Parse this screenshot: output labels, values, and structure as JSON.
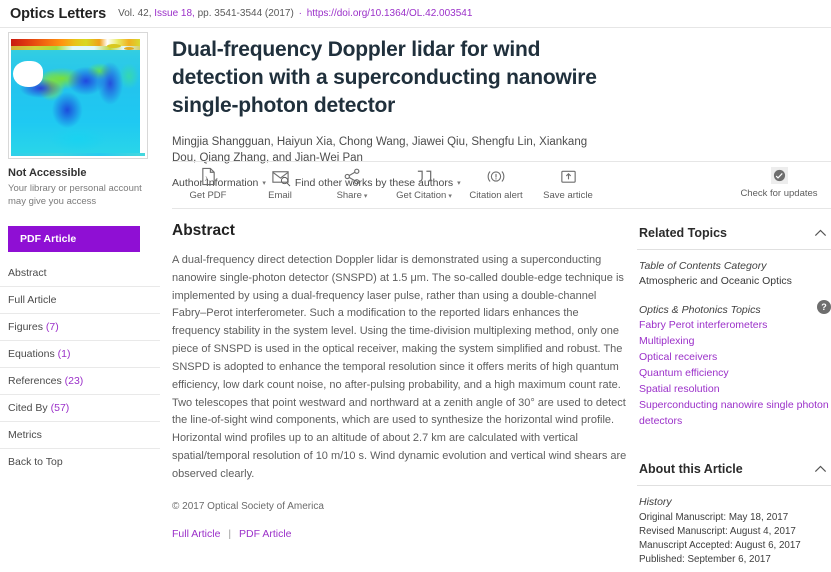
{
  "journal_header": {
    "name": "Optics Letters",
    "volume": "Vol. 42,",
    "issue": "Issue 18,",
    "pages": "pp. 3541-3544 (2017)",
    "separator": "·",
    "doi": "https://doi.org/10.1364/OL.42.003541"
  },
  "left": {
    "thumbnail_name": "article-figure-thumbnail",
    "access_title": "Not Accessible",
    "access_sub": "Your library or personal account may give you access",
    "pdf_button": "PDF Article",
    "nav": [
      {
        "label": "Abstract",
        "count": ""
      },
      {
        "label": "Full Article",
        "count": ""
      },
      {
        "label": "Figures",
        "count": "(7)"
      },
      {
        "label": "Equations",
        "count": "(1)"
      },
      {
        "label": "References",
        "count": "(23)"
      },
      {
        "label": "Cited By",
        "count": "(57)"
      },
      {
        "label": "Metrics",
        "count": ""
      },
      {
        "label": "Back to Top",
        "count": ""
      }
    ]
  },
  "article": {
    "title": "Dual-frequency Doppler lidar for wind detection with a superconducting nanowire single-photon detector",
    "authors": "Mingjia Shangguan, Haiyun Xia, Chong Wang, Jiawei Qiu, Shengfu Lin, Xiankang Dou, Qiang Zhang, and Jian-Wei Pan",
    "author_information": "Author Information",
    "find_other_works": "Find other works by these authors",
    "caret": "▾"
  },
  "toolbar": {
    "items": [
      {
        "label": "Get PDF",
        "icon": "pdf-file-icon",
        "caret": ""
      },
      {
        "label": "Email",
        "icon": "envelope-icon",
        "caret": ""
      },
      {
        "label": "Share",
        "icon": "share-nodes-icon",
        "caret": "▾"
      },
      {
        "label": "Get Citation",
        "icon": "quote-marks-icon",
        "caret": "▾"
      },
      {
        "label": "Citation alert",
        "icon": "citation-alert-icon",
        "caret": ""
      },
      {
        "label": "Save article",
        "icon": "save-box-icon",
        "caret": ""
      }
    ],
    "updates": {
      "label": "Check for updates",
      "icon": "crossmark-badge-icon"
    }
  },
  "abstract": {
    "heading": "Abstract",
    "body": "A dual-frequency direct detection Doppler lidar is demonstrated using a superconducting nanowire single-photon detector (SNSPD) at 1.5 μm. The so-called double-edge technique is implemented by using a dual-frequency laser pulse, rather than using a double-channel Fabry–Perot interferometer. Such a modification to the reported lidars enhances the frequency stability in the system level. Using the time-division multiplexing method, only one piece of SNSPD is used in the optical receiver, making the system simplified and robust. The SNSPD is adopted to enhance the temporal resolution since it offers merits of high quantum efficiency, low dark count noise, no after-pulsing probability, and a high maximum count rate. Two telescopes that point westward and northward at a zenith angle of 30° are used to detect the line-of-sight wind components, which are used to synthesize the horizontal wind profile. Horizontal wind profiles up to an altitude of about 2.7 km are calculated with vertical spatial/temporal resolution of 10 m/10 s. Wind dynamic evolution and vertical wind shears are observed clearly.",
    "copyright": "© 2017 Optical Society of America",
    "link_full": "Full Article",
    "link_pdf": "PDF Article",
    "link_divider": "|"
  },
  "related_topics": {
    "title": "Related Topics",
    "chevron": "ⱏ",
    "toc_label": "Table of Contents Category",
    "toc_value": "Atmospheric and Oceanic Optics",
    "topics_label": "Optics & Photonics Topics",
    "help_badge": "?",
    "topics": [
      "Fabry Perot interferometers",
      "Multiplexing",
      "Optical receivers",
      "Quantum efficiency",
      "Spatial resolution",
      "Superconducting nanowire single photon detectors"
    ]
  },
  "about_article": {
    "title": "About this Article",
    "chevron": "ⱏ",
    "history_label": "History",
    "history": [
      "Original Manuscript: May 18, 2017",
      "Revised Manuscript: August 4, 2017",
      "Manuscript Accepted: August 6, 2017",
      "Published: September 6, 2017"
    ]
  },
  "colors": {
    "brand_purple": "#8f0fd4",
    "link_purple": "#9b30c9",
    "title_dark": "#20303c",
    "body_gray": "#5e5e5e"
  }
}
